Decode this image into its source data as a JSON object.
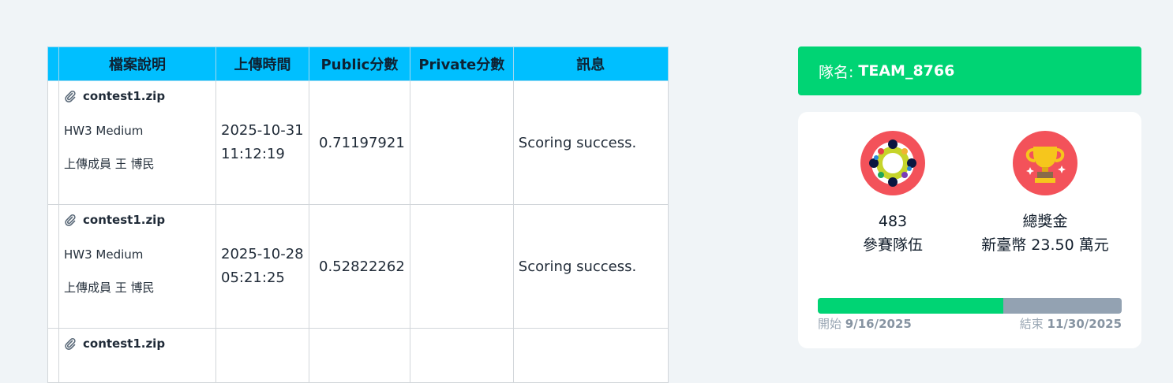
{
  "table": {
    "headers": [
      "檔案說明",
      "上傳時間",
      "Public分數",
      "Private分數",
      "訊息"
    ],
    "rows": [
      {
        "file": "contest1.zip",
        "description": "HW3 Medium",
        "uploader": "上傳成員 王 博民",
        "date": "2025-10-31",
        "time": "11:12:19",
        "public_score": "0.71197921",
        "private_score": "",
        "message": "Scoring success."
      },
      {
        "file": "contest1.zip",
        "description": "HW3 Medium",
        "uploader": "上傳成員 王 博民",
        "date": "2025-10-28",
        "time": "05:21:25",
        "public_score": "0.52822262",
        "private_score": "",
        "message": "Scoring success."
      },
      {
        "file": "contest1.zip"
      }
    ]
  },
  "team": {
    "label": "隊名:",
    "name": "TEAM_8766"
  },
  "stats": {
    "teams_count": "483",
    "teams_label": "參賽隊伍",
    "prize_label": "總獎金",
    "prize_value": "新臺幣 23.50 萬元",
    "progress_fraction": 0.61,
    "start_label": "開始",
    "start_date": "9/16/2025",
    "end_label": "結束",
    "end_date": "11/30/2025"
  },
  "icons": {
    "paperclip": "paperclip-icon",
    "teams": "teams-circle-icon",
    "trophy": "trophy-icon"
  },
  "colors": {
    "header_bg": "#00bfff",
    "team_bar": "#00d474",
    "progress_fill": "#00d474",
    "progress_track": "#93a2b2",
    "icon_bg": "#f3525a"
  }
}
